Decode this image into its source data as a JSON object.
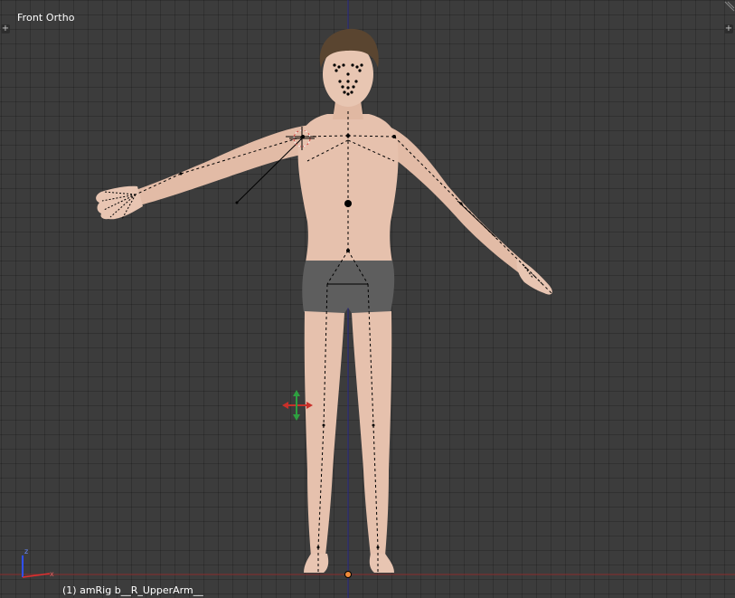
{
  "viewport": {
    "view_label": "Front Ortho",
    "status_text": "(1) amRig b__R_UpperArm__"
  },
  "axes_gizmo": {
    "z_label": "z",
    "x_label": "x"
  },
  "icons": {
    "corner_left": "plus-icon",
    "corner_right": "plus-icon",
    "manipulator": "translate-manipulator-icon"
  },
  "colors": {
    "grid_background": "#3c3c3c",
    "x_axis": "#9a2a2a",
    "z_axis": "#2a2a9a",
    "skin": "#e6c1ad",
    "underwear": "#606060",
    "hair": "#5a4530",
    "bone_line": "#000000",
    "manip_red": "#c8302a",
    "manip_green": "#2ea040",
    "origin_dot": "#f08a3a"
  }
}
